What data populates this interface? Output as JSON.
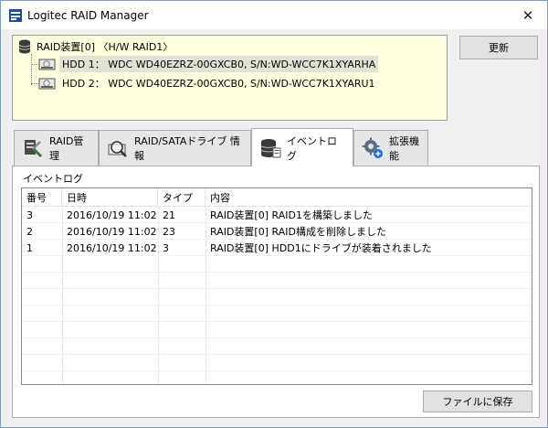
{
  "window": {
    "title": "Logitec RAID Manager"
  },
  "tree": {
    "root_label": "RAID装置[0] 〈H/W RAID1〉",
    "children": [
      {
        "label": "HDD 1： WDC WD40EZRZ-00GXCB0, S/N:WD-WCC7K1XYARHA"
      },
      {
        "label": "HDD 2： WDC WD40EZRZ-00GXCB0, S/N:WD-WCC7K1XYARU1"
      }
    ]
  },
  "buttons": {
    "refresh": "更新",
    "save_file": "ファイルに保存"
  },
  "tabs": [
    {
      "label": "RAID管理",
      "icon": "raid-tools-icon"
    },
    {
      "label": "RAID/SATAドライブ 情報",
      "icon": "drive-inspect-icon"
    },
    {
      "label": "イベントログ",
      "icon": "database-icon",
      "active": true
    },
    {
      "label": "拡張機能",
      "icon": "gear-plus-icon"
    }
  ],
  "event_log": {
    "group_label": "イベントログ",
    "columns": [
      "番号",
      "日時",
      "タイプ",
      "内容"
    ],
    "rows": [
      [
        "3",
        "2016/10/19 11:02",
        "21",
        "RAID装置[0] RAID1を構築しました"
      ],
      [
        "2",
        "2016/10/19 11:02",
        "23",
        "RAID装置[0] RAID構成を削除しました"
      ],
      [
        "1",
        "2016/10/19 11:02",
        "3",
        "RAID装置[0] HDD1にドライブが装着されました"
      ]
    ]
  },
  "colors": {
    "tree_bg": "#ffffe0",
    "selected_row": "#e2e2d4",
    "window_bg": "#f0f0f0"
  }
}
